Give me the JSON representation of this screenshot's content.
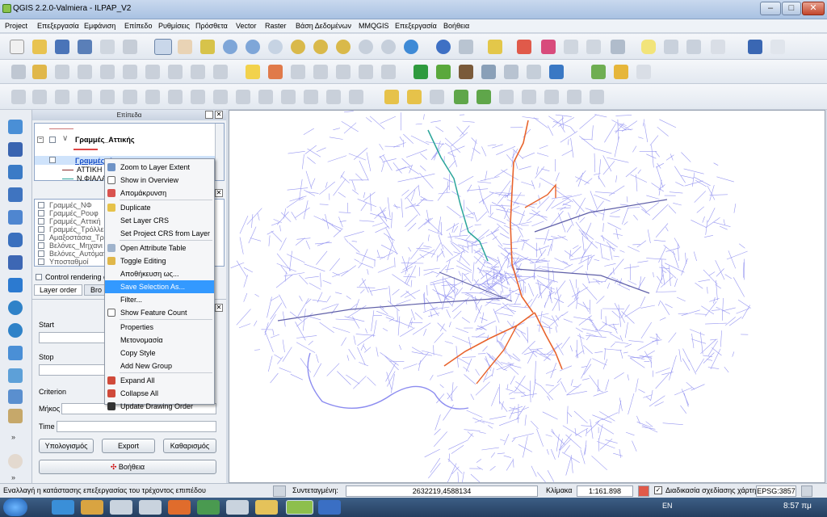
{
  "window": {
    "title": "QGIS 2.2.0-Valmiera - ILPAP_V2",
    "buttons": [
      "–",
      "□",
      "✕"
    ]
  },
  "menu": [
    "Project",
    "Επεξεργασία",
    "Εμφάνιση",
    "Επίπεδο",
    "Ρυθμίσεις",
    "Πρόσθετα",
    "Vector",
    "Raster",
    "Βάση Δεδομένων",
    "MMQGIS",
    "Επεξεργασία",
    "Βοήθεια"
  ],
  "layers_panel": {
    "title": "Επίπεδα",
    "group": "Γραμμές_Αττικής",
    "selected_layer": "Γραμμές_Ατ...",
    "sub_items": [
      "ΑΤΤΙΚΗ",
      "Ν.ΦΙΑΛΑ"
    ],
    "order_items": [
      "Γραμμές_ΝΦ",
      "Γραμμές_Ρουφ",
      "Γραμμές_Αττική",
      "Γραμμές_Τρόλλε",
      "Αμαξοστάσια_Τρό",
      "Βελόνες_Μηχανι",
      "Βελόνες_Αυτόματ",
      "Υποσταθμοί"
    ],
    "control_rendering": "Control rendering o",
    "tabs": [
      "Layer order",
      "Bro"
    ]
  },
  "route_panel": {
    "start_label": "Start",
    "stop_label": "Stop",
    "criterion_label": "Criterion",
    "criterion_value": "Μήκος",
    "time_label": "Time",
    "buttons": [
      "Υπολογισμός",
      "Export",
      "Καθαρισμός"
    ],
    "help": "Βοήθεια"
  },
  "context_menu": [
    {
      "label": "Zoom to Layer Extent",
      "icon": "zoom-icon"
    },
    {
      "label": "Show in Overview",
      "icon": "checkbox-icon"
    },
    {
      "label": "Απομάκρυνση",
      "icon": "remove-icon"
    },
    {
      "label": "Duplicate",
      "icon": "duplicate-icon"
    },
    {
      "label": "Set Layer CRS",
      "icon": ""
    },
    {
      "label": "Set Project CRS from Layer",
      "icon": ""
    },
    {
      "label": "Open Attribute Table",
      "icon": "table-icon"
    },
    {
      "label": "Toggle Editing",
      "icon": "pencil-icon"
    },
    {
      "label": "Αποθήκευση ως...",
      "icon": ""
    },
    {
      "label": "Save Selection As...",
      "icon": "",
      "highlighted": true
    },
    {
      "label": "Filter...",
      "icon": ""
    },
    {
      "label": "Show Feature Count",
      "icon": "checkbox-icon"
    },
    {
      "label": "Properties",
      "icon": ""
    },
    {
      "label": "Μετονομασία",
      "icon": ""
    },
    {
      "label": "Copy Style",
      "icon": ""
    },
    {
      "label": "Add New Group",
      "icon": ""
    },
    {
      "label": "Expand All",
      "icon": "expand-icon"
    },
    {
      "label": "Collapse All",
      "icon": "collapse-icon"
    },
    {
      "label": "Update Drawing Order",
      "icon": "order-icon"
    }
  ],
  "status": {
    "hint": "Εναλλαγή η κατάστασης επεξεργασίας του τρέχοντος επιπέδου",
    "coord_label": "Συντεταγμένη:",
    "coordinate": "2632219,4588134",
    "scale_label": "Κλίμακα",
    "scale": "1:161.898",
    "render_label": "Διαδικασία σχεδίασης χάρτη",
    "epsg": "EPSG:3857"
  },
  "taskbar": {
    "lang": "EN",
    "time": "8:57 πμ"
  },
  "colors": {
    "map_lines": "#8c8cf0",
    "route_orange": "#e8632c",
    "route_teal": "#2aa59a",
    "highlight": "#3399ff"
  }
}
